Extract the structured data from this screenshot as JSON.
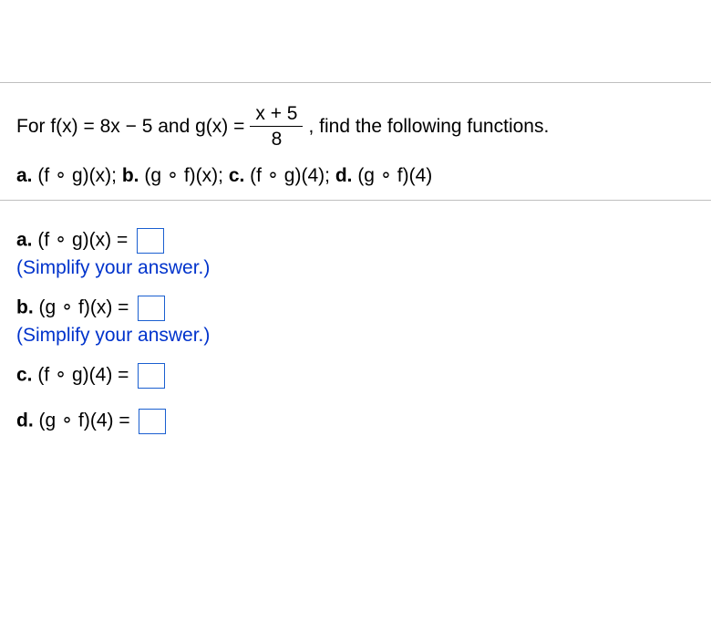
{
  "top_spacer_height": 90,
  "question": {
    "prefix": "For f(x) = 8x − 5 and g(x) = ",
    "fraction": {
      "num": "x + 5",
      "den": "8"
    },
    "suffix": ", find the following functions."
  },
  "parts_list": {
    "a_label": "a.",
    "a_text": " (f ∘ g)(x); ",
    "b_label": "b.",
    "b_text": " (g ∘ f)(x); ",
    "c_label": "c.",
    "c_text": " (f ∘ g)(4); ",
    "d_label": "d.",
    "d_text": " (g ∘ f)(4)"
  },
  "answers": {
    "a": {
      "label": "a.",
      "expr": " (f ∘ g)(x) = ",
      "hint": "(Simplify your answer.)"
    },
    "b": {
      "label": "b.",
      "expr": " (g ∘ f)(x) = ",
      "hint": "(Simplify your answer.)"
    },
    "c": {
      "label": "c.",
      "expr": " (f ∘ g)(4) = "
    },
    "d": {
      "label": "d.",
      "expr": " (g ∘ f)(4) = "
    }
  }
}
